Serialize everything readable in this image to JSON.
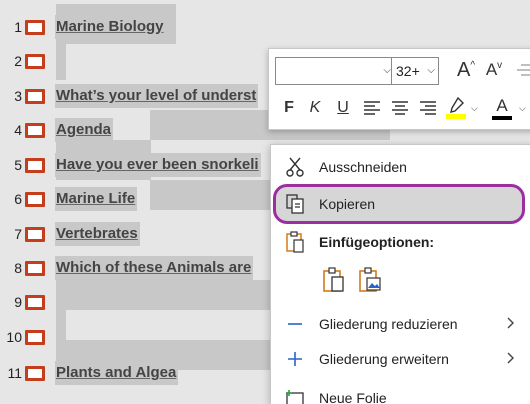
{
  "outline": {
    "slides": [
      {
        "num": "1",
        "title": "Marine Biology"
      },
      {
        "num": "2",
        "title": ""
      },
      {
        "num": "3",
        "title": "What’s your level of underst"
      },
      {
        "num": "4",
        "title": "Agenda"
      },
      {
        "num": "5",
        "title": "Have you ever been snorkeli"
      },
      {
        "num": "6",
        "title": "Marine Life"
      },
      {
        "num": "7",
        "title": "Vertebrates"
      },
      {
        "num": "8",
        "title": "Which of these Animals are"
      },
      {
        "num": "9",
        "title": ""
      },
      {
        "num": "10",
        "title": ""
      },
      {
        "num": "11",
        "title": "Plants and Algea"
      }
    ]
  },
  "mini_toolbar": {
    "font_name": "",
    "font_size": "32+",
    "grow_font": "A",
    "shrink_font": "A",
    "bold": "F",
    "italic": "K",
    "underline": "U",
    "font_color_label": "A",
    "highlight_color": "#ffff00",
    "font_color": "#000000"
  },
  "context_menu": {
    "cut": "Ausschneiden",
    "copy": "Kopieren",
    "paste_options": "Einfügeoptionen:",
    "collapse": "Gliederung reduzieren",
    "expand": "Gliederung erweitern",
    "new_slide": "Neue Folie"
  },
  "colors": {
    "slide_icon": "#c43e1c",
    "focus_ring": "#9b2fa1",
    "accent_blue": "#2b64c8",
    "paste_orange": "#d47b1a"
  }
}
